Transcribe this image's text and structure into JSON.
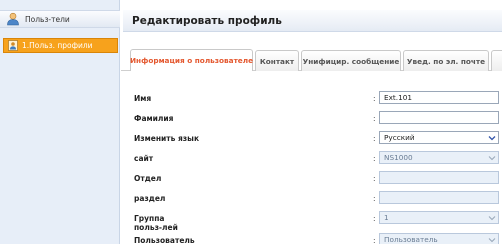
{
  "sidebar": {
    "header": {
      "label": "Польз-тели",
      "icon": "user-icon"
    },
    "items": [
      {
        "label": "1.Польз. профили",
        "icon": "user-icon",
        "active": true
      }
    ]
  },
  "main": {
    "title": "Редактировать профиль",
    "tabs": [
      {
        "label": "Информация о пользователе",
        "active": true
      },
      {
        "label": "Контакт"
      },
      {
        "label": "Унифицир. сообщение"
      },
      {
        "label": "Увед. по эл. почте"
      }
    ],
    "form": {
      "rows": [
        {
          "label": "Имя",
          "value": "Ext.101",
          "type": "text"
        },
        {
          "label": "Фамилия",
          "value": "",
          "type": "text"
        },
        {
          "label": "Изменить язык",
          "value": "Русский",
          "type": "select"
        },
        {
          "label": "сайт",
          "value": "NS1000",
          "type": "select",
          "disabled": true
        },
        {
          "label": "Отдел",
          "value": "",
          "type": "text",
          "disabled": true
        },
        {
          "label": "раздел",
          "value": "",
          "type": "text",
          "disabled": true
        },
        {
          "label": "Группа польз-лей",
          "value": "1",
          "type": "select",
          "disabled": true
        },
        {
          "label": "Пользователь",
          "value": "Пользователь",
          "type": "select",
          "disabled": true
        }
      ]
    }
  },
  "colors": {
    "accent": "#f7a21c",
    "active_tab_text": "#e4572e",
    "sidebar_bg": "#e7eef8"
  }
}
